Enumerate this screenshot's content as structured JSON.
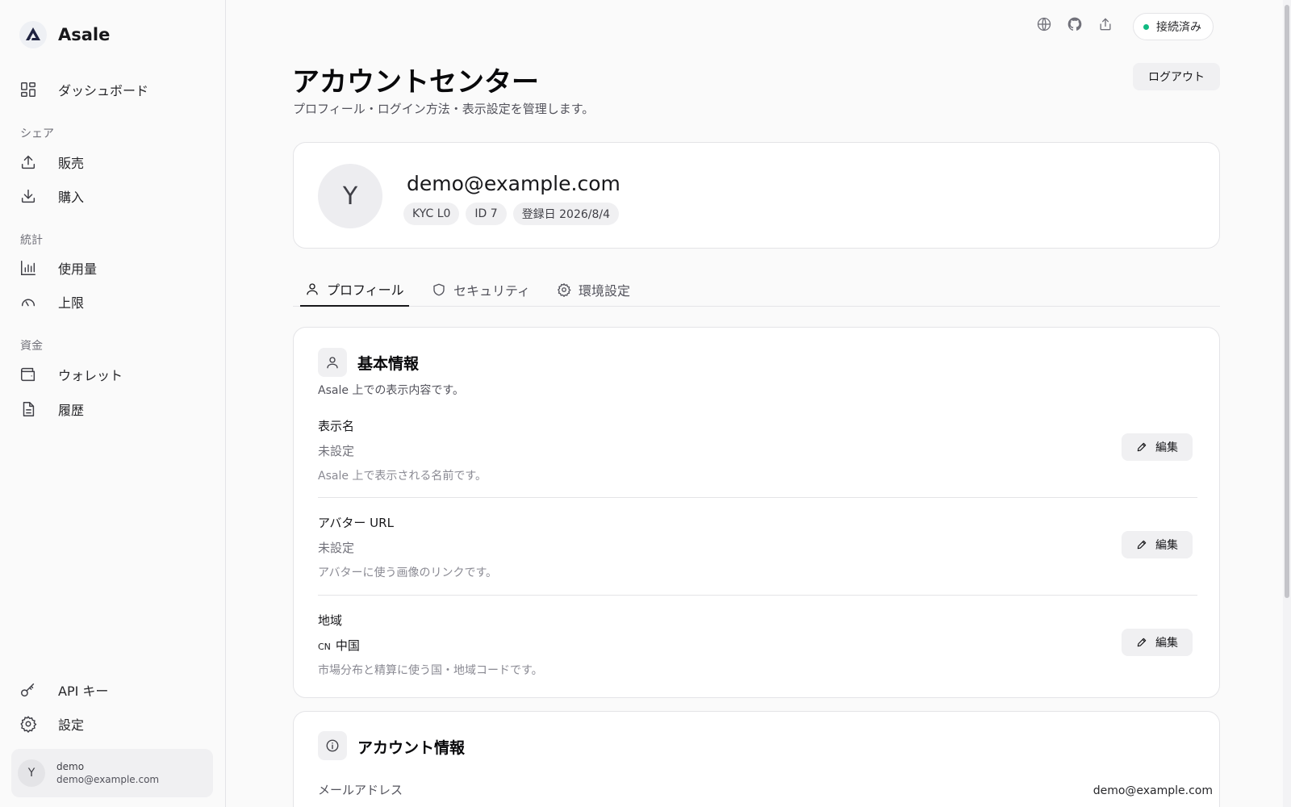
{
  "app": {
    "name": "Asale"
  },
  "sidebar": {
    "dashboard": "ダッシュボード",
    "sections": {
      "share": "シェア",
      "stats": "統計",
      "funds": "資金"
    },
    "items": {
      "sales": "販売",
      "purchase": "購入",
      "usage": "使用量",
      "limit": "上限",
      "wallet": "ウォレット",
      "history": "履歴",
      "api_keys": "API キー",
      "settings": "設定"
    },
    "user": {
      "initial": "Y",
      "name": "demo",
      "email": "demo@example.com"
    }
  },
  "topbar": {
    "icons": [
      "globe-icon",
      "github-icon",
      "share-icon"
    ],
    "status": "接続済み",
    "status_color": "#10b981"
  },
  "header": {
    "title": "アカウントセンター",
    "subtitle": "プロフィール・ログイン方法・表示設定を管理します。",
    "logout": "ログアウト"
  },
  "profile": {
    "initial": "Y",
    "email": "demo@example.com",
    "badges": [
      "KYC L0",
      "ID 7",
      "登録日 2026/8/4"
    ]
  },
  "tabs": [
    {
      "label": "プロフィール",
      "active": true
    },
    {
      "label": "セキュリティ",
      "active": false
    },
    {
      "label": "環境設定",
      "active": false
    }
  ],
  "basic_info": {
    "title": "基本情報",
    "description": "Asale 上での表示内容です。",
    "edit_label": "編集",
    "fields": [
      {
        "label": "表示名",
        "value": "未設定",
        "hint": "Asale 上で表示される名前です。"
      },
      {
        "label": "アバター URL",
        "value": "未設定",
        "hint": "アバターに使う画像のリンクです。"
      },
      {
        "label": "地域",
        "code": "CN",
        "value": "中国",
        "hint": "市場分布と精算に使う国・地域コードです。"
      }
    ]
  },
  "account_info": {
    "title": "アカウント情報",
    "email_label": "メールアドレス",
    "email_value": "demo@example.com"
  }
}
